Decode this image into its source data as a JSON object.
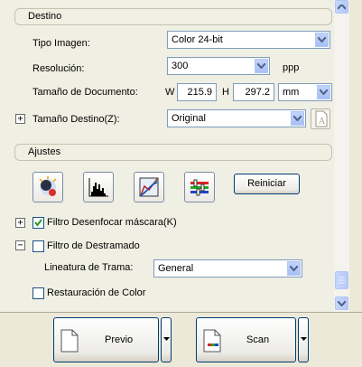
{
  "destino": {
    "header": "Destino",
    "tipo_imagen": {
      "label": "Tipo Imagen:",
      "value": "Color 24-bit"
    },
    "resolucion": {
      "label": "Resolución:",
      "value": "300",
      "unit": "ppp"
    },
    "tamano_documento": {
      "label": "Tamaño de Documento:",
      "w_label": "W",
      "w_value": "215.9",
      "h_label": "H",
      "h_value": "297.2",
      "unit": "mm"
    },
    "tamano_destino": {
      "label": "Tamaño Destino(Z):",
      "value": "Original"
    }
  },
  "ajustes": {
    "header": "Ajustes",
    "tools": [
      "auto-exposure-icon",
      "histogram-icon",
      "tone-curve-icon",
      "color-palette-icon"
    ],
    "reiniciar_label": "Reiniciar",
    "filtro_desenfocar": {
      "label": "Filtro Desenfocar máscara(K)",
      "checked": true
    },
    "filtro_destramado": {
      "label": "Filtro de Destramado",
      "checked": false
    },
    "lineatura": {
      "label": "Lineatura de Trama:",
      "value": "General"
    },
    "restauracion": {
      "label": "Restauración de Color",
      "checked": false
    }
  },
  "footer": {
    "previo_label": "Previo",
    "scan_label": "Scan"
  }
}
